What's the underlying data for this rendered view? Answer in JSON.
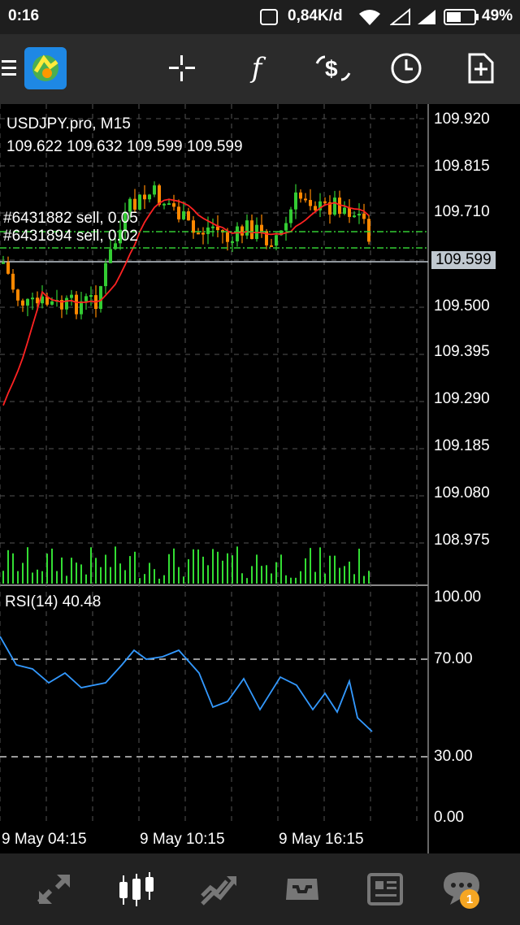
{
  "status_bar": {
    "time": "0:16",
    "net_speed": "0,84K/d",
    "battery": "49%"
  },
  "toolbar": {
    "buttons": [
      {
        "name": "menu-icon"
      },
      {
        "name": "app-logo-icon"
      },
      {
        "name": "crosshair-icon"
      },
      {
        "name": "indicators-icon",
        "label": "f"
      },
      {
        "name": "trade-icon"
      },
      {
        "name": "timeframe-icon"
      },
      {
        "name": "add-object-icon"
      }
    ]
  },
  "chart": {
    "symbol_line": "USDJPY.pro, M15",
    "ohlc_line": "109.622 109.632 109.599 109.599",
    "orders": [
      "#6431882 sell, 0.05",
      "#6431894 sell, 0.02"
    ],
    "current_price": "109.599",
    "price_axis": [
      "109.920",
      "109.815",
      "109.710",
      "109.500",
      "109.395",
      "109.290",
      "109.185",
      "109.080",
      "108.975"
    ],
    "rsi_label": "RSI(14) 40.48",
    "rsi_axis": [
      "100.00",
      "70.00",
      "30.00",
      "0.00"
    ],
    "time_axis": [
      "9 May 04:15",
      "9 May 10:15",
      "9 May 16:15"
    ],
    "colors": {
      "bull_candle": "#33cc33",
      "bear_candle": "#ff8800",
      "ma_line": "#ff2222",
      "rsi_line": "#3399ff",
      "volume": "#33dd33",
      "order_line": "#33cc33"
    }
  },
  "bottom_nav": {
    "items": [
      {
        "name": "quotes-icon"
      },
      {
        "name": "chart-icon",
        "active": true
      },
      {
        "name": "trade-nav-icon"
      },
      {
        "name": "history-icon"
      },
      {
        "name": "news-icon"
      },
      {
        "name": "messages-icon",
        "badge": "1"
      }
    ]
  }
}
